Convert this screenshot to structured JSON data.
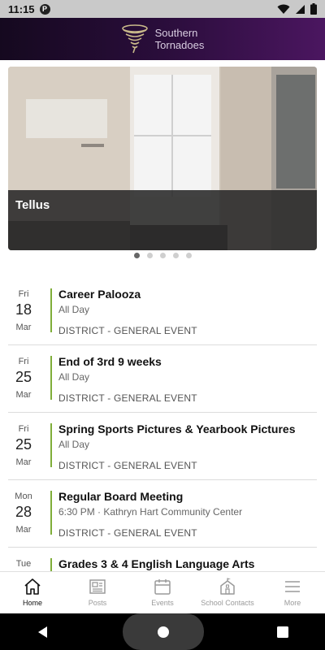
{
  "status": {
    "time": "11:15",
    "app_icon": "P"
  },
  "header": {
    "logo_line1": "Southern",
    "logo_line2": "Tornadoes",
    "accent": "#4b1660"
  },
  "hero": {
    "caption": "Tellus",
    "dots": 5,
    "active_dot": 0
  },
  "events": [
    {
      "dow": "Fri",
      "day": "18",
      "mon": "Mar",
      "title": "Career Palooza",
      "time": "All Day",
      "category": "DISTRICT - GENERAL EVENT"
    },
    {
      "dow": "Fri",
      "day": "25",
      "mon": "Mar",
      "title": "End of 3rd 9 weeks",
      "time": "All Day",
      "category": "DISTRICT - GENERAL EVENT"
    },
    {
      "dow": "Fri",
      "day": "25",
      "mon": "Mar",
      "title": "Spring Sports Pictures & Yearbook Pictures",
      "time": "All Day",
      "category": "DISTRICT - GENERAL EVENT"
    },
    {
      "dow": "Mon",
      "day": "28",
      "mon": "Mar",
      "title": "Regular Board Meeting",
      "time": "6:30 PM · Kathryn Hart Community Center",
      "category": "DISTRICT - GENERAL EVENT"
    },
    {
      "dow": "Tue",
      "day": "",
      "mon": "",
      "title": "Grades 3 & 4 English Language Arts",
      "time": "",
      "category": ""
    }
  ],
  "nav": {
    "home": "Home",
    "posts": "Posts",
    "events": "Events",
    "contacts": "School Contacts",
    "more": "More"
  },
  "colors": {
    "event_bar": "#7fae3a"
  }
}
